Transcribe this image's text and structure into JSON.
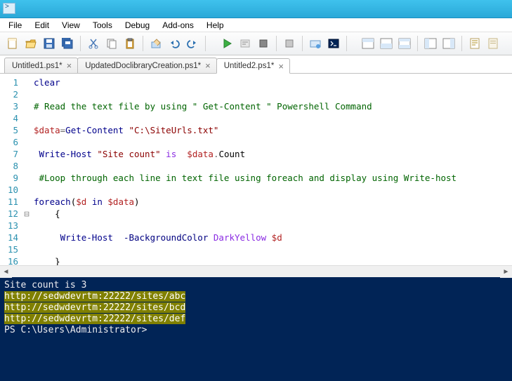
{
  "menu": {
    "file": "File",
    "edit": "Edit",
    "view": "View",
    "tools": "Tools",
    "debug": "Debug",
    "addons": "Add-ons",
    "help": "Help"
  },
  "tabs": [
    {
      "label": "Untitled1.ps1*"
    },
    {
      "label": "UpdatedDoclibraryCreation.ps1*"
    },
    {
      "label": "Untitled2.ps1*"
    }
  ],
  "code": {
    "l1": "clear",
    "l3": "# Read the text file by using \" Get-Content \" Powershell Command",
    "l5_var": "$data",
    "l5_eq": "=",
    "l5_cmd": "Get-Content",
    "l5_str": "\"C:\\SiteUrls.txt\"",
    "l7_cmd": " Write-Host",
    "l7_str": "\"Site count\"",
    "l7_is": "is",
    "l7_var": "$data",
    "l7_dot": ".",
    "l7_mem": "Count",
    "l9": " #Loop through each line in text file using foreach and display using Write-host",
    "l11_fe": "foreach",
    "l11_lp": "(",
    "l11_d": "$d",
    "l11_in": "in",
    "l11_data": "$data",
    "l11_rp": ")",
    "l12": "    {",
    "l14_cmd": "    Write-Host",
    "l14_p": "-BackgroundColor",
    "l14_v": "DarkYellow",
    "l14_var": "$d",
    "l16": "    }"
  },
  "lines": {
    "n1": "1",
    "n2": "2",
    "n3": "3",
    "n4": "4",
    "n5": "5",
    "n6": "6",
    "n7": "7",
    "n8": "8",
    "n9": "9",
    "n10": "10",
    "n11": "11",
    "n12": "12",
    "n13": "13",
    "n14": "14",
    "n15": "15",
    "n16": "16"
  },
  "fold": "⊟",
  "console": {
    "l1": "Site count is 3",
    "l2": "http://sedwdevrtm:22222/sites/abc",
    "l3": "http://sedwdevrtm:22222/sites/bcd",
    "l4": "http://sedwdevrtm:22222/sites/def",
    "prompt": "PS C:\\Users\\Administrator>"
  }
}
